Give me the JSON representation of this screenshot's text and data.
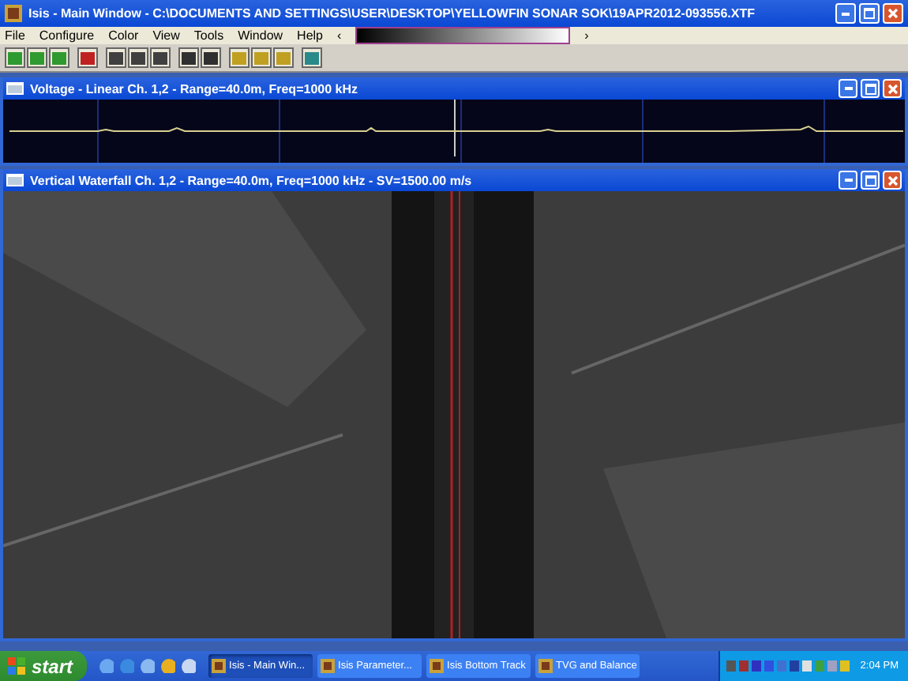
{
  "window": {
    "title": "Isis - Main Window - C:\\DOCUMENTS AND SETTINGS\\USER\\DESKTOP\\YELLOWFIN SONAR SOK\\19APR2012-093556.XTF"
  },
  "menu": [
    "File",
    "Configure",
    "Color",
    "View",
    "Tools",
    "Window",
    "Help"
  ],
  "palette": {
    "left": "‹",
    "right": "›"
  },
  "child_windows": [
    {
      "kind": "voltage",
      "title": "Voltage - Linear Ch. 1,2 - Range=40.0m, Freq=1000 kHz"
    },
    {
      "kind": "waterfall",
      "title": "Vertical Waterfall Ch. 1,2 - Range=40.0m, Freq=1000 kHz - SV=1500.00 m/s"
    }
  ],
  "taskbar": {
    "start": "start",
    "tasks": [
      {
        "label": "Isis - Main Win...",
        "selected": true
      },
      {
        "label": "Isis Parameter...",
        "selected": false
      },
      {
        "label": "Isis Bottom Track",
        "selected": false
      },
      {
        "label": "TVG and Balance",
        "selected": false
      }
    ],
    "clock": "2:04 PM"
  }
}
